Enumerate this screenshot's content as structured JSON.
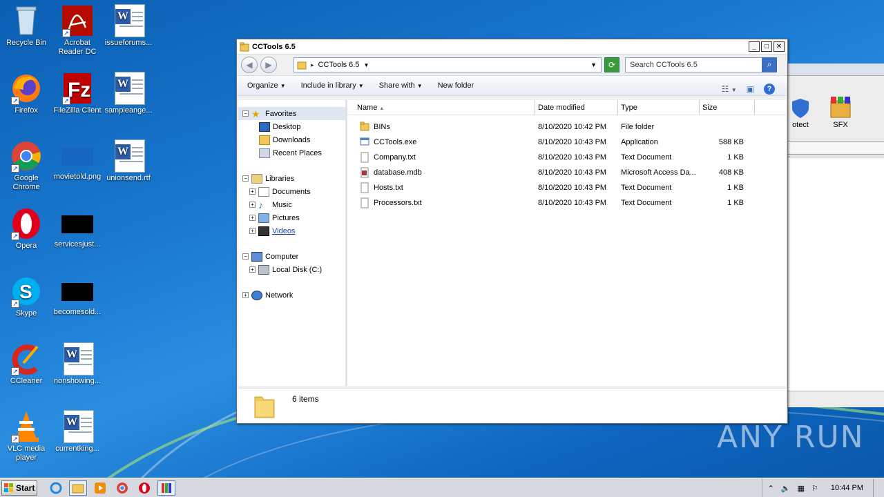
{
  "desktop": {
    "icons": [
      {
        "label": "Recycle Bin"
      },
      {
        "label": "Acrobat\nReader DC"
      },
      {
        "label": "issueforums..."
      },
      {
        "label": "Firefox"
      },
      {
        "label": "FileZilla Client"
      },
      {
        "label": "sampleange..."
      },
      {
        "label": "Google\nChrome"
      },
      {
        "label": "movietold.png"
      },
      {
        "label": "unionsend.rtf"
      },
      {
        "label": "Opera"
      },
      {
        "label": "servicesjust..."
      },
      {
        "label": "Skype"
      },
      {
        "label": "becomesold..."
      },
      {
        "label": "CCleaner"
      },
      {
        "label": "nonshowing..."
      },
      {
        "label": "VLC media\nplayer"
      },
      {
        "label": "currentking..."
      }
    ]
  },
  "background_window": {
    "items": [
      {
        "label": "otect"
      },
      {
        "label": "SFX"
      }
    ]
  },
  "window": {
    "title": "CCTools 6.5",
    "address": "CCTools 6.5",
    "search_placeholder": "Search CCTools 6.5",
    "commands": {
      "organize": "Organize",
      "include": "Include in library",
      "share": "Share with",
      "new_folder": "New folder"
    },
    "nav": {
      "favorites": "Favorites",
      "desktop": "Desktop",
      "downloads": "Downloads",
      "recent": "Recent Places",
      "libraries": "Libraries",
      "documents": "Documents",
      "music": "Music",
      "pictures": "Pictures",
      "videos": "Videos",
      "computer": "Computer",
      "local_disk": "Local Disk (C:)",
      "network": "Network"
    },
    "columns": {
      "name": "Name",
      "date": "Date modified",
      "type": "Type",
      "size": "Size"
    },
    "files": [
      {
        "name": "BINs",
        "date": "8/10/2020 10:42 PM",
        "type": "File folder",
        "size": ""
      },
      {
        "name": "CCTools.exe",
        "date": "8/10/2020 10:43 PM",
        "type": "Application",
        "size": "588 KB"
      },
      {
        "name": "Company.txt",
        "date": "8/10/2020 10:43 PM",
        "type": "Text Document",
        "size": "1 KB"
      },
      {
        "name": "database.mdb",
        "date": "8/10/2020 10:43 PM",
        "type": "Microsoft Access Da...",
        "size": "408 KB"
      },
      {
        "name": "Hosts.txt",
        "date": "8/10/2020 10:43 PM",
        "type": "Text Document",
        "size": "1 KB"
      },
      {
        "name": "Processors.txt",
        "date": "8/10/2020 10:43 PM",
        "type": "Text Document",
        "size": "1 KB"
      }
    ],
    "status": "6 items"
  },
  "taskbar": {
    "start": "Start",
    "clock": "10:44 PM"
  },
  "watermark": "ANY RUN"
}
